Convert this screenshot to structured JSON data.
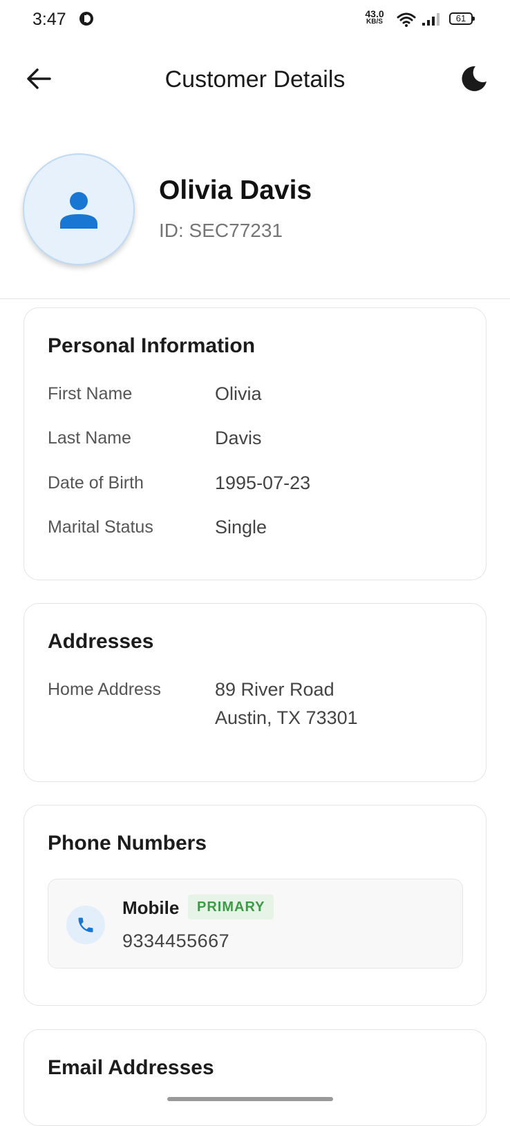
{
  "status_bar": {
    "time": "3:47",
    "net_speed_value": "43.0",
    "net_speed_unit": "KB/S",
    "battery": "61"
  },
  "header": {
    "title": "Customer Details",
    "back_icon": "arrow-back-icon",
    "theme_icon": "moon-icon"
  },
  "profile": {
    "name": "Olivia Davis",
    "id_text": "ID: SEC77231",
    "avatar_icon": "person-icon"
  },
  "personal_info": {
    "title": "Personal Information",
    "rows": [
      {
        "label": "First Name",
        "value": "Olivia"
      },
      {
        "label": "Last Name",
        "value": "Davis"
      },
      {
        "label": "Date of Birth",
        "value": "1995-07-23"
      },
      {
        "label": "Marital Status",
        "value": "Single"
      }
    ]
  },
  "addresses": {
    "title": "Addresses",
    "label": "Home Address",
    "line1": "89 River Road",
    "line2": "Austin, TX 73301"
  },
  "phones": {
    "title": "Phone Numbers",
    "items": [
      {
        "type": "Mobile",
        "badge": "PRIMARY",
        "number": "9334455667",
        "icon": "phone-icon"
      }
    ]
  },
  "emails": {
    "title": "Email Addresses"
  },
  "colors": {
    "accent": "#1976d2",
    "avatar_bg": "#e6f1fc",
    "badge_bg": "#e6f4e7",
    "badge_text": "#3f9a45"
  }
}
